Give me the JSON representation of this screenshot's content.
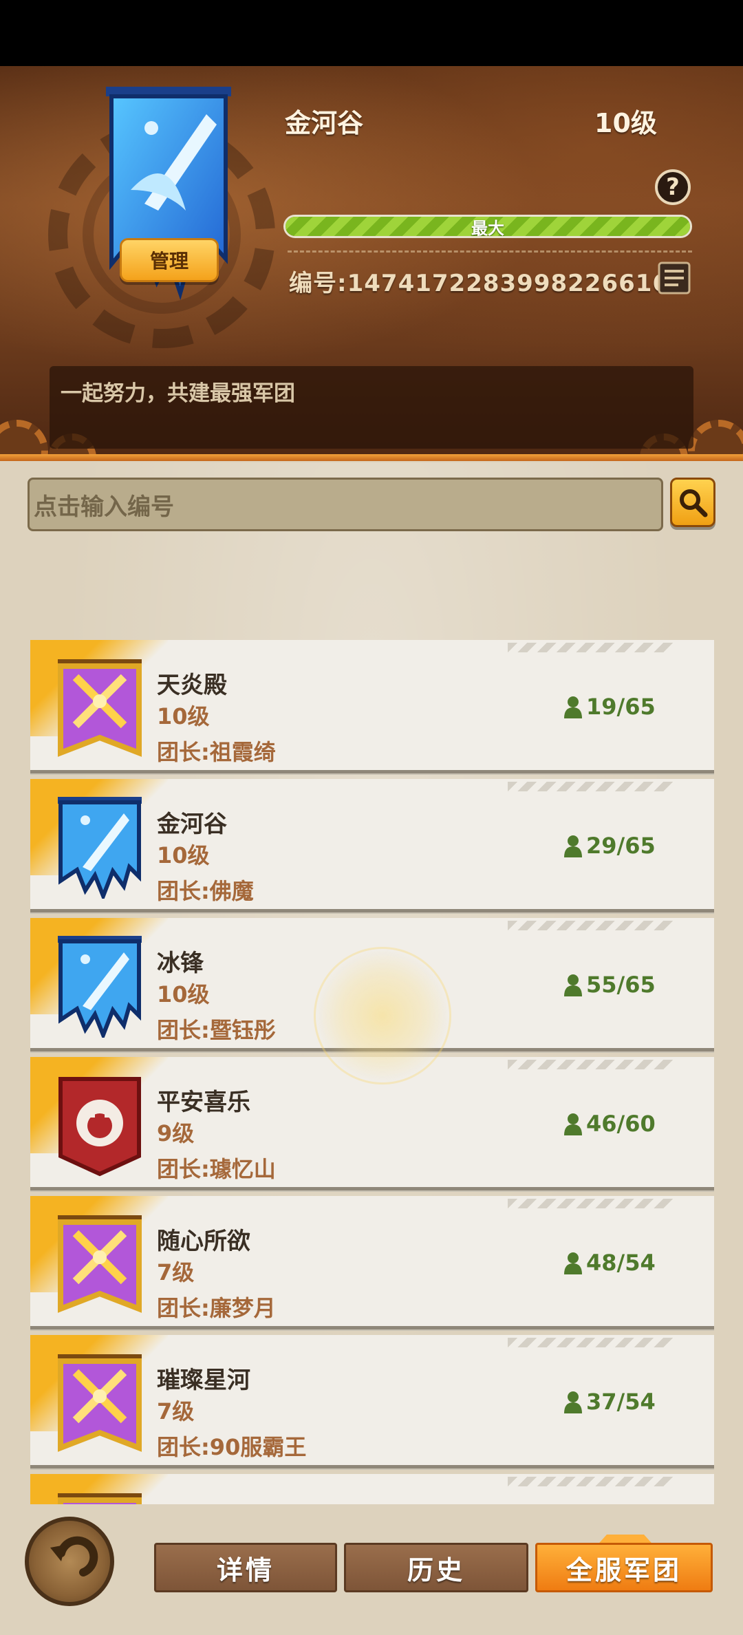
{
  "header": {
    "guild_name": "金河谷",
    "level": "10级",
    "help_symbol": "?",
    "xp_label": "最大",
    "xp_fraction": 1.0,
    "guild_id": "编号:1474172283998226616",
    "manage_label": "管理",
    "motto": "一起努力，共建最强军团",
    "emblem": "blue-banner-sword-emblem"
  },
  "search": {
    "placeholder": "点击输入编号",
    "icon": "search-icon"
  },
  "guilds": [
    {
      "name": "天炎殿",
      "level": "10级",
      "leader": "团长:祖霞绮",
      "members": "19/65",
      "emblem": "purple-gold-swords-emblem"
    },
    {
      "name": "金河谷",
      "level": "10级",
      "leader": "团长:佛魔",
      "members": "29/65",
      "emblem": "blue-banner-sword-emblem"
    },
    {
      "name": "冰锋",
      "level": "10级",
      "leader": "团长:暨钰彤",
      "members": "55/65",
      "emblem": "blue-banner-sword-emblem"
    },
    {
      "name": "平安喜乐",
      "level": "9级",
      "leader": "团长:璩忆山",
      "members": "46/60",
      "emblem": "red-lion-shield-emblem"
    },
    {
      "name": "随心所欲",
      "level": "7级",
      "leader": "团长:廉梦月",
      "members": "48/54",
      "emblem": "purple-gold-swords-emblem"
    },
    {
      "name": "璀璨星河",
      "level": "7级",
      "leader": "团长:90服霸王",
      "members": "37/54",
      "emblem": "purple-gold-swords-emblem"
    },
    {
      "name": "",
      "level": "",
      "leader": "",
      "members": "",
      "emblem": "purple-gold-swords-emblem"
    }
  ],
  "tabs": {
    "details": "详情",
    "history": "历史",
    "all_server": "全服军团",
    "active": "all_server"
  },
  "colors": {
    "accent_orange": "#ef7c12",
    "xp_green": "#9fd43a",
    "member_green": "#4f7a2c",
    "level_brown": "#a5683a"
  }
}
